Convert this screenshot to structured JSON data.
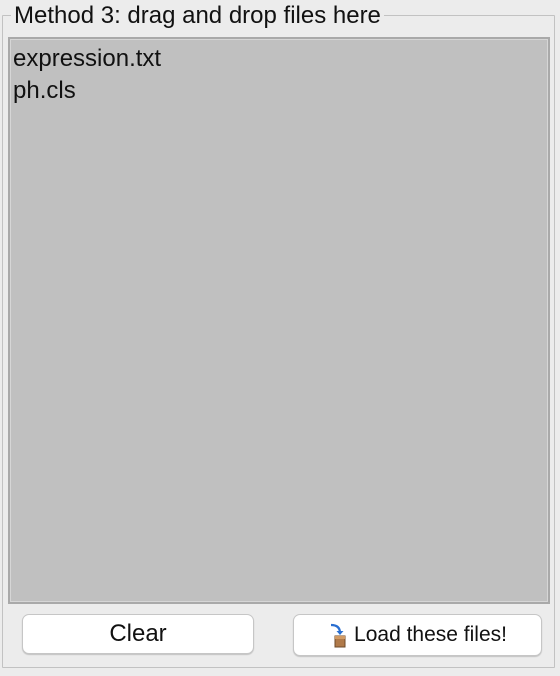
{
  "panel": {
    "title": "Method 3: drag and drop files here"
  },
  "file_list": {
    "items": [
      "expression.txt",
      "ph.cls"
    ]
  },
  "buttons": {
    "clear_label": "Clear",
    "load_label": "Load these files!",
    "load_icon": "load-file-icon"
  }
}
